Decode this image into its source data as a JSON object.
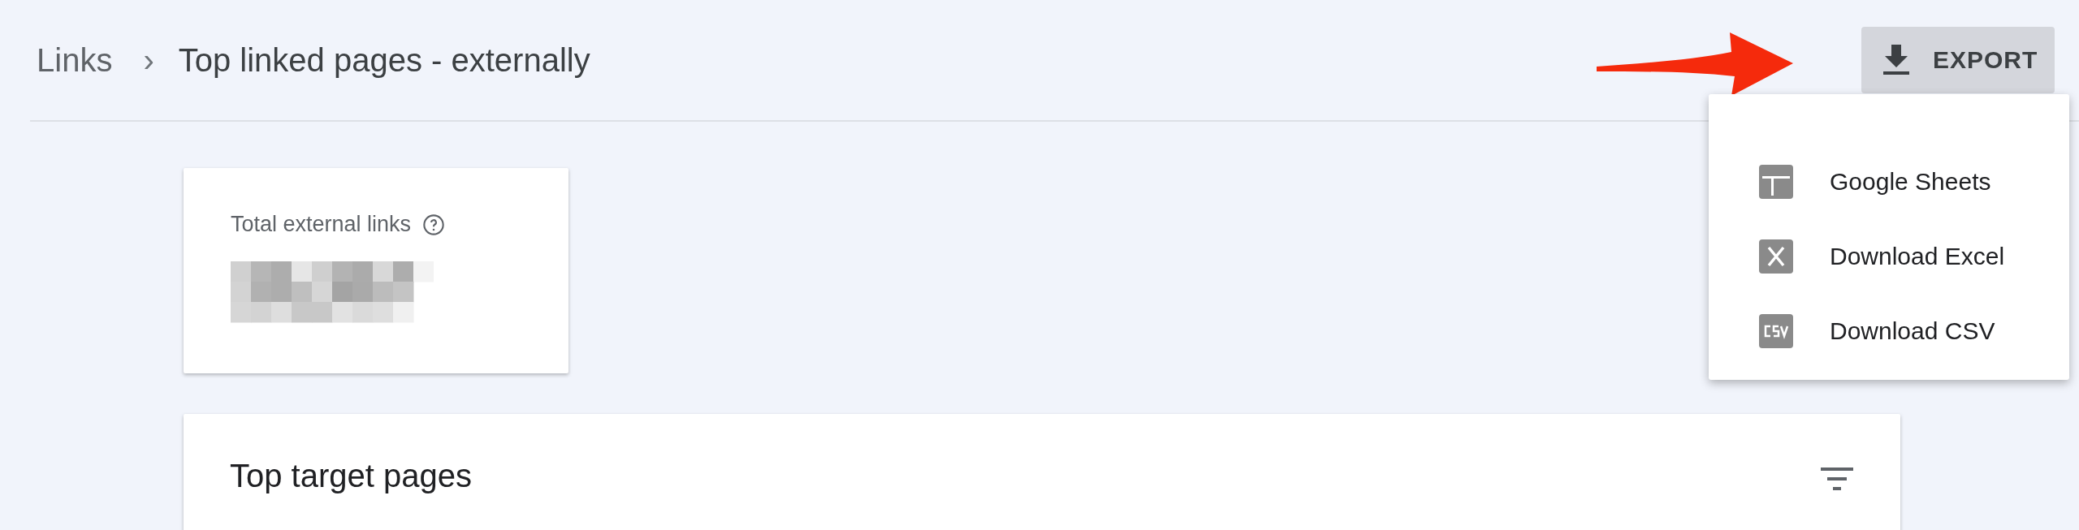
{
  "breadcrumb": {
    "parent": "Links",
    "separator": "›",
    "current": "Top linked pages - externally"
  },
  "export_button": {
    "label": "EXPORT"
  },
  "export_menu": [
    {
      "kind": "sheets",
      "label": "Google Sheets"
    },
    {
      "kind": "excel",
      "label": "Download Excel"
    },
    {
      "kind": "csv",
      "label": "Download CSV"
    }
  ],
  "summary_card": {
    "label": "Total external links",
    "value": {
      "kind": "pixelated"
    }
  },
  "table_card": {
    "title": "Top target pages"
  }
}
